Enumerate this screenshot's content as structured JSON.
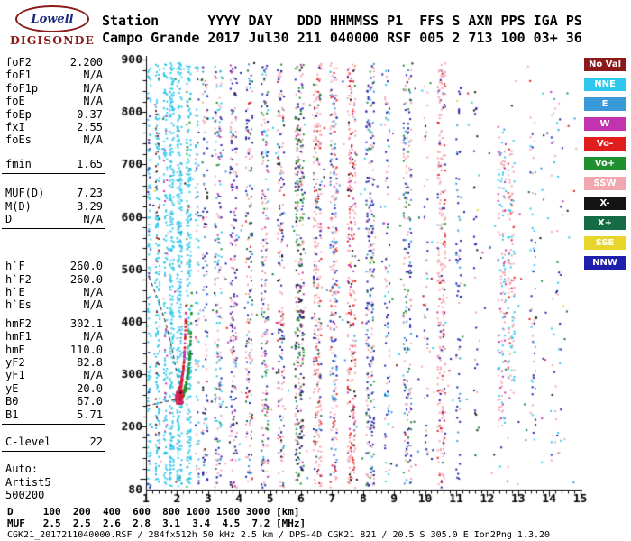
{
  "logo": {
    "top": "Lowell",
    "bottom": "DIGISONDE"
  },
  "header": {
    "line1": "Station      YYYY DAY   DDD HHMMSS P1  FFS S AXN PPS IGA PS",
    "line2": "Campo Grande 2017 Jul30 211 040000 RSF 005 2 713 100 03+ 36"
  },
  "params": {
    "groups": [
      {
        "rule": false,
        "gap": 12,
        "rows": [
          [
            "foF2",
            "2.200"
          ],
          [
            "foF1",
            "N/A"
          ],
          [
            "foF1p",
            "N/A"
          ],
          [
            "foE",
            "N/A"
          ],
          [
            "foEp",
            "0.37"
          ],
          [
            "fxI",
            "2.55"
          ],
          [
            "foEs",
            "N/A"
          ]
        ]
      },
      {
        "rule": true,
        "gap": 14,
        "rows": [
          [
            "fmin",
            "1.65"
          ]
        ]
      },
      {
        "rule": true,
        "gap": 34,
        "rows": [
          [
            "MUF(D)",
            "7.23"
          ],
          [
            "M(D)",
            "3.29"
          ],
          [
            "D",
            "N/A"
          ]
        ]
      },
      {
        "rule": false,
        "gap": 6,
        "rows": [
          [
            "h`F",
            "260.0"
          ],
          [
            "h`F2",
            "260.0"
          ],
          [
            "h`E",
            "N/A"
          ],
          [
            "h`Es",
            "N/A"
          ]
        ]
      },
      {
        "rule": true,
        "gap": 12,
        "rows": [
          [
            "hmF2",
            "302.1"
          ],
          [
            "hmF1",
            "N/A"
          ],
          [
            "hmE",
            "110.0"
          ],
          [
            "yF2",
            "82.8"
          ],
          [
            "yF1",
            "N/A"
          ],
          [
            "yE",
            "20.0"
          ],
          [
            "B0",
            "67.0"
          ],
          [
            "B1",
            "5.71"
          ]
        ]
      },
      {
        "rule": true,
        "gap": 12,
        "rows": [
          [
            "C-level",
            "22"
          ]
        ]
      },
      {
        "rule": false,
        "gap": 0,
        "rows": [
          [
            "Auto:",
            ""
          ],
          [
            "Artist5",
            ""
          ],
          [
            "500200",
            ""
          ]
        ]
      }
    ]
  },
  "footer": {
    "d_line": "D     100  200  400  600  800 1000 1500 3000 [km]",
    "muf_line": "MUF   2.5  2.5  2.6  2.8  3.1  3.4  4.5  7.2 [MHz]",
    "info": "CGK21_2017211040000.RSF / 284fx512h 50 kHz 2.5 km / DPS-4D CGK21 821 / 20.5 S 305.0 E Ion2Png 1.3.20"
  },
  "chart_data": {
    "type": "scatter",
    "title": "Digisonde ionogram, Campo Grande, 2017 Jul30 day 211 04:00:00 UT",
    "xlabel": "[MHz]",
    "ylabel": "[km]",
    "xlim": [
      1,
      15
    ],
    "ylim": [
      80,
      900
    ],
    "grid": false,
    "legend_position": "right",
    "x_ticks": [
      1,
      2,
      3,
      4,
      5,
      6,
      7,
      8,
      9,
      10,
      11,
      12,
      13,
      14,
      15
    ],
    "y_tick_labels": [
      900,
      800,
      700,
      600,
      500,
      400,
      300,
      200,
      80
    ],
    "legend": [
      {
        "label": "No Val",
        "color": "#8B1A1A"
      },
      {
        "label": "NNE",
        "color": "#2EC8EE"
      },
      {
        "label": "E",
        "color": "#3A9AD9"
      },
      {
        "label": "W",
        "color": "#C233B0"
      },
      {
        "label": "Vo-",
        "color": "#E11D1D"
      },
      {
        "label": "Vo+",
        "color": "#1F8F2F"
      },
      {
        "label": "SSW",
        "color": "#F2A6B0"
      },
      {
        "label": "X-",
        "color": "#141414"
      },
      {
        "label": "X+",
        "color": "#156B45"
      },
      {
        "label": "SSE",
        "color": "#E8D52C"
      },
      {
        "label": "NNW",
        "color": "#1F1FAE"
      }
    ],
    "palette": {
      "NoVal": "#8B1A1A",
      "NNE": "#2EC8EE",
      "E": "#3A9AD9",
      "W": "#C233B0",
      "Vo-": "#E11D1D",
      "Vo+": "#1F8F2F",
      "SSW": "#F2A6B0",
      "X-": "#141414",
      "X+": "#156B45",
      "SSE": "#E8D52C",
      "NNW": "#1F1FAE"
    },
    "seed": 1337,
    "key_values": {
      "foF2_MHz": "2.200",
      "fxI_MHz": "2.55",
      "fmin_MHz": "1.65",
      "hF_km": "260.0",
      "hmF2_km": "302.1",
      "MUF_D": "7.23"
    },
    "background_noise": {
      "n": 380,
      "x": [
        1.02,
        14.85
      ],
      "y": [
        85,
        895
      ],
      "colors": {
        "NNE": 0.16,
        "E": 0.1,
        "W": 0.08,
        "Vo-": 0.07,
        "Vo+": 0.1,
        "SSW": 0.2,
        "X-": 0.07,
        "X+": 0.05,
        "SSE": 0.03,
        "NNW": 0.12,
        "NoVal": 0.02
      }
    },
    "stripes": [
      {
        "x": 1.08,
        "w": 0.04,
        "y": [
          85,
          895
        ],
        "n": 110,
        "c": {
          "NNE": 0.7,
          "NNW": 0.3
        }
      },
      {
        "x": 1.35,
        "w": 0.06,
        "y": [
          85,
          895
        ],
        "n": 190,
        "c": {
          "NNE": 0.8,
          "NoVal": 0.2
        }
      },
      {
        "x": 1.6,
        "w": 0.05,
        "y": [
          85,
          895
        ],
        "n": 130,
        "c": {
          "NNE": 0.85,
          "W": 0.15
        }
      },
      {
        "x": 1.8,
        "w": 0.06,
        "y": [
          85,
          895
        ],
        "n": 250,
        "c": {
          "NNE": 1
        }
      },
      {
        "x": 2.05,
        "w": 0.07,
        "y": [
          85,
          895
        ],
        "n": 270,
        "c": {
          "NNE": 0.93,
          "E": 0.07
        }
      },
      {
        "x": 2.35,
        "w": 0.06,
        "y": [
          85,
          895
        ],
        "n": 230,
        "c": {
          "NNE": 0.88,
          "Vo+": 0.12
        }
      },
      {
        "x": 2.62,
        "w": 0.05,
        "y": [
          90,
          890
        ],
        "n": 80,
        "c": {
          "NNE": 0.5,
          "NNW": 0.25,
          "SSW": 0.25
        }
      },
      {
        "x": 2.88,
        "w": 0.07,
        "y": [
          90,
          890
        ],
        "n": 110,
        "c": {
          "NNW": 0.35,
          "SSW": 0.3,
          "X-": 0.15,
          "E": 0.2
        }
      },
      {
        "x": 3.3,
        "w": 0.1,
        "y": [
          85,
          895
        ],
        "n": 180,
        "c": {
          "SSW": 0.33,
          "NNE": 0.24,
          "NNW": 0.2,
          "Vo+": 0.12,
          "W": 0.11
        }
      },
      {
        "x": 3.8,
        "w": 0.1,
        "y": [
          85,
          895
        ],
        "n": 190,
        "c": {
          "NNW": 0.34,
          "SSW": 0.3,
          "W": 0.14,
          "E": 0.12,
          "X-": 0.1
        }
      },
      {
        "x": 4.3,
        "w": 0.1,
        "y": [
          85,
          895
        ],
        "n": 175,
        "c": {
          "SSW": 0.4,
          "NNW": 0.24,
          "E": 0.14,
          "Vo-": 0.12,
          "X+": 0.1
        }
      },
      {
        "x": 4.8,
        "w": 0.1,
        "y": [
          85,
          895
        ],
        "n": 200,
        "c": {
          "SSW": 0.34,
          "Vo+": 0.2,
          "NNW": 0.2,
          "W": 0.14,
          "NNE": 0.12
        }
      },
      {
        "x": 5.32,
        "w": 0.1,
        "y": [
          85,
          895
        ],
        "n": 185,
        "c": {
          "SSW": 0.4,
          "NNW": 0.28,
          "X-": 0.1,
          "E": 0.12,
          "Vo-": 0.1
        }
      },
      {
        "x": 5.92,
        "w": 0.13,
        "y": [
          85,
          895
        ],
        "n": 330,
        "c": {
          "Vo+": 0.3,
          "X-": 0.2,
          "SSW": 0.24,
          "NNW": 0.15,
          "W": 0.11
        }
      },
      {
        "x": 6.5,
        "w": 0.12,
        "y": [
          85,
          895
        ],
        "n": 300,
        "c": {
          "SSW": 0.58,
          "Vo-": 0.16,
          "NNW": 0.15,
          "X+": 0.11
        }
      },
      {
        "x": 7.02,
        "w": 0.1,
        "y": [
          85,
          895
        ],
        "n": 225,
        "c": {
          "SSW": 0.45,
          "E": 0.2,
          "Vo-": 0.15,
          "NNW": 0.2
        }
      },
      {
        "x": 7.6,
        "w": 0.12,
        "y": [
          85,
          895
        ],
        "n": 280,
        "c": {
          "SSW": 0.55,
          "Vo-": 0.2,
          "W": 0.14,
          "X-": 0.11
        }
      },
      {
        "x": 8.2,
        "w": 0.12,
        "y": [
          85,
          895
        ],
        "n": 245,
        "c": {
          "NNW": 0.45,
          "SSW": 0.3,
          "E": 0.14,
          "Vo+": 0.11
        }
      },
      {
        "x": 8.75,
        "w": 0.07,
        "y": [
          95,
          880
        ],
        "n": 90,
        "c": {
          "NNW": 0.4,
          "SSW": 0.3,
          "NNE": 0.3
        }
      },
      {
        "x": 9.4,
        "w": 0.12,
        "y": [
          85,
          895
        ],
        "n": 210,
        "c": {
          "SSW": 0.35,
          "NNW": 0.25,
          "Vo+": 0.2,
          "E": 0.2
        }
      },
      {
        "x": 10.0,
        "w": 0.05,
        "y": [
          120,
          860
        ],
        "n": 45,
        "c": {
          "NNW": 0.5,
          "SSW": 0.5
        }
      },
      {
        "x": 10.5,
        "w": 0.12,
        "y": [
          85,
          895
        ],
        "n": 260,
        "c": {
          "SSW": 0.68,
          "Vo-": 0.16,
          "NNW": 0.16
        }
      },
      {
        "x": 11.05,
        "w": 0.07,
        "y": [
          100,
          870
        ],
        "n": 70,
        "c": {
          "NNW": 0.6,
          "E": 0.2,
          "SSW": 0.2
        }
      },
      {
        "x": 11.6,
        "w": 0.05,
        "y": [
          150,
          850
        ],
        "n": 28,
        "c": {
          "NNW": 0.5,
          "X-": 0.3,
          "SSW": 0.2
        }
      },
      {
        "x": 12.45,
        "w": 0.12,
        "y": [
          200,
          780
        ],
        "n": 130,
        "c": {
          "SSW": 0.55,
          "NNE": 0.3,
          "W": 0.15
        }
      },
      {
        "x": 12.75,
        "w": 0.1,
        "y": [
          250,
          750
        ],
        "n": 110,
        "c": {
          "NNE": 0.45,
          "SSW": 0.45,
          "Vo-": 0.1
        }
      },
      {
        "x": 13.45,
        "w": 0.08,
        "y": [
          150,
          820
        ],
        "n": 55,
        "c": {
          "NNE": 0.4,
          "NNW": 0.3,
          "SSW": 0.3
        }
      },
      {
        "x": 14.2,
        "w": 0.15,
        "y": [
          120,
          860
        ],
        "n": 40,
        "c": {
          "NNW": 0.4,
          "SSW": 0.3,
          "NNE": 0.3
        }
      }
    ],
    "traces": [
      {
        "f": [
          1.92,
          2.26
        ],
        "fc": 2.32,
        "h0": 255,
        "k": 14,
        "n": 140,
        "jit": 6,
        "c": {
          "Vo-": 0.75,
          "W": 0.25
        }
      },
      {
        "f": [
          2.1,
          2.44
        ],
        "fc": 2.5,
        "h0": 258,
        "k": 14,
        "n": 90,
        "jit": 6,
        "c": {
          "Vo+": 1
        }
      }
    ],
    "cluster": {
      "x": 2.05,
      "w": 0.09,
      "y": [
        246,
        272
      ],
      "n": 70,
      "c": {
        "Vo-": 0.6,
        "W": 0.25,
        "X-": 0.15
      }
    },
    "dashed_lines": [
      [
        [
          1.1,
          485
        ],
        [
          1.4,
          440
        ],
        [
          1.65,
          395
        ],
        [
          1.85,
          345
        ],
        [
          2.0,
          300
        ],
        [
          2.1,
          272
        ],
        [
          2.16,
          258
        ]
      ],
      [
        [
          1.02,
          240
        ],
        [
          1.5,
          246
        ],
        [
          1.95,
          252
        ]
      ]
    ]
  }
}
